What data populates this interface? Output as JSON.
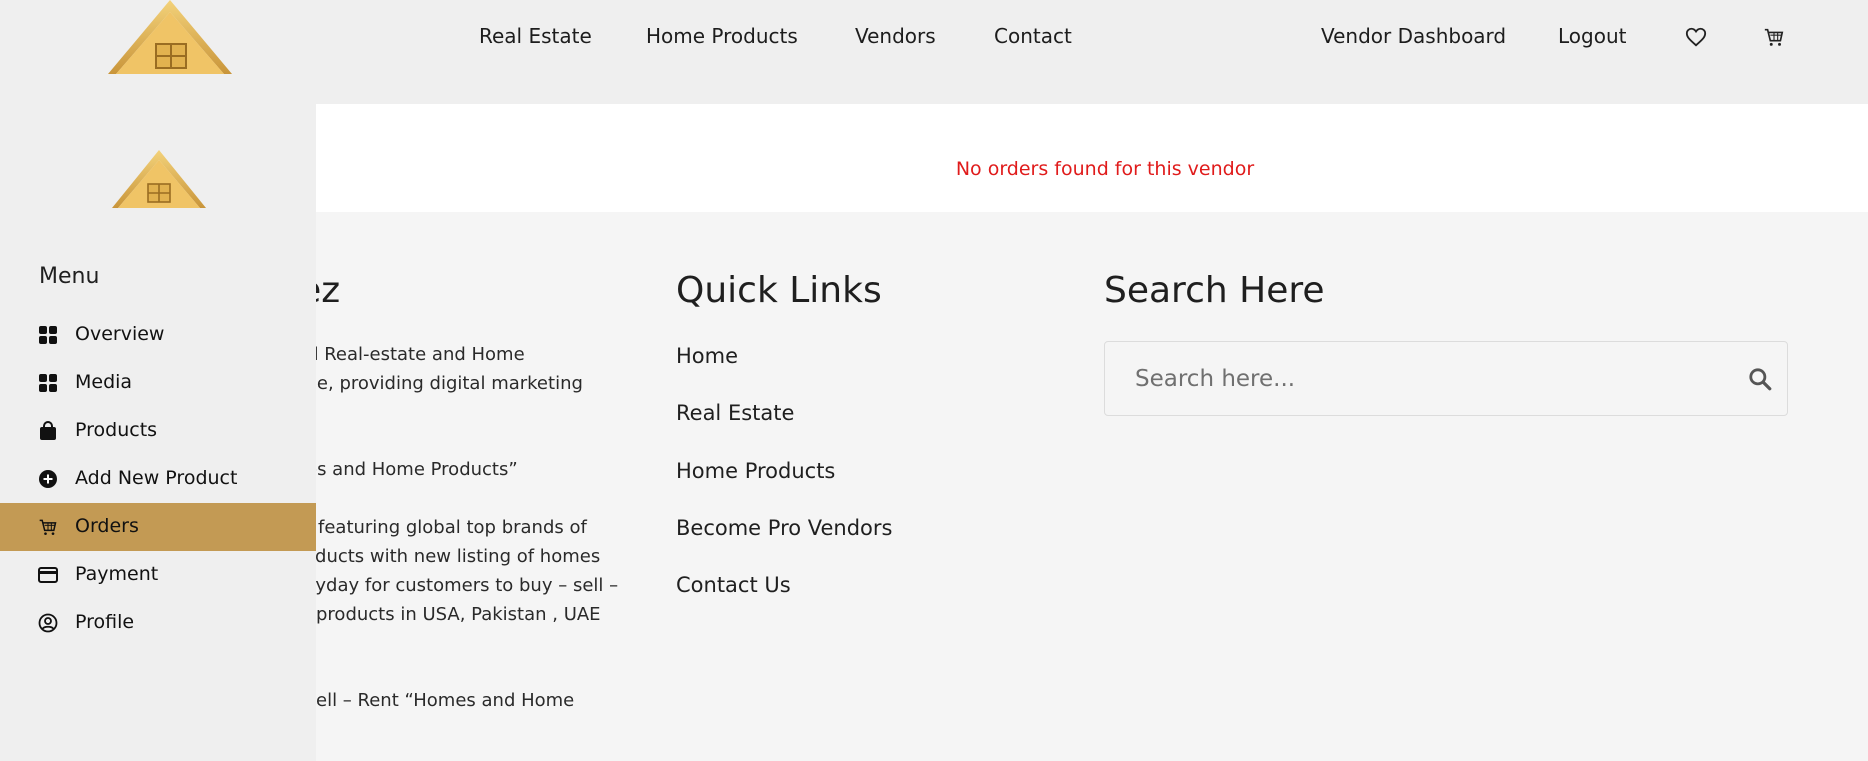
{
  "header": {
    "nav": [
      "Real Estate",
      "Home Products",
      "Vendors",
      "Contact"
    ],
    "right_links": [
      "Vendor Dashboard",
      "Logout"
    ],
    "icons": [
      "heart-icon",
      "cart-icon"
    ]
  },
  "main": {
    "message": "No orders found for this vendor",
    "message_color": "#e01b1b"
  },
  "footer": {
    "about_heading": "mez",
    "about_lines": [
      "ed Real-estate and Home",
      "ace, providing digital marketing",
      "es and Home Products”",
      "featuring global top brands of",
      "oducts with new listing of homes",
      "ryday for customers to buy – sell –",
      " products in USA, Pakistan , UAE",
      "ell – Rent “Homes and Home"
    ],
    "quick_heading": "Quick Links",
    "quick_links": [
      "Home",
      "Real Estate",
      "Home Products",
      "Become Pro Vendors",
      "Contact Us"
    ],
    "search_heading": "Search Here",
    "search_placeholder": "Search here..."
  },
  "sidebar": {
    "menu_title": "Menu",
    "items": [
      {
        "label": "Overview",
        "icon": "grid-icon"
      },
      {
        "label": "Media",
        "icon": "grid-icon"
      },
      {
        "label": "Products",
        "icon": "shopping-bag-icon"
      },
      {
        "label": "Add New Product",
        "icon": "plus-circle-icon"
      },
      {
        "label": "Orders",
        "icon": "cart-icon",
        "active": true
      },
      {
        "label": "Payment",
        "icon": "credit-card-icon"
      },
      {
        "label": "Profile",
        "icon": "user-circle-icon"
      }
    ],
    "active_color": "#c39a54"
  },
  "brand": {
    "gold": "#e2b24f"
  }
}
